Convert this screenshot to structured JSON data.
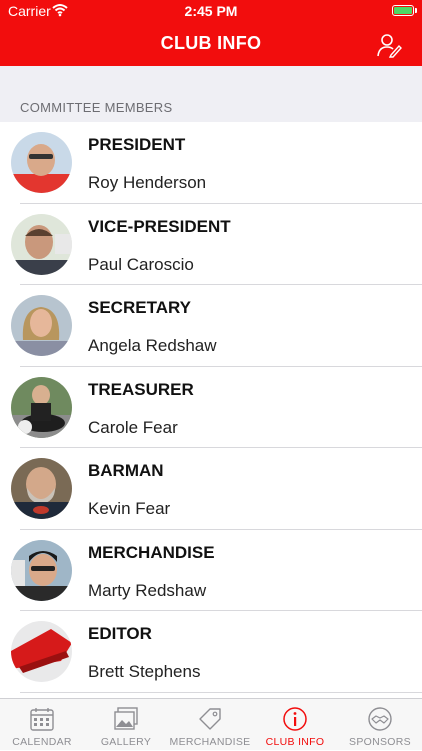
{
  "status": {
    "carrier": "Carrier",
    "time": "2:45 PM"
  },
  "nav": {
    "title": "CLUB INFO",
    "right_icon": "person-edit-icon"
  },
  "section": {
    "header": "COMMITTEE MEMBERS"
  },
  "members": [
    {
      "role": "PRESIDENT",
      "name": "Roy Henderson"
    },
    {
      "role": "VICE-PRESIDENT",
      "name": "Paul Caroscio"
    },
    {
      "role": "SECRETARY",
      "name": "Angela Redshaw"
    },
    {
      "role": "TREASURER",
      "name": "Carole Fear"
    },
    {
      "role": "BARMAN",
      "name": "Kevin Fear"
    },
    {
      "role": "MERCHANDISE",
      "name": "Marty Redshaw"
    },
    {
      "role": "EDITOR",
      "name": "Brett Stephens"
    }
  ],
  "tabs": [
    {
      "label": "CALENDAR",
      "icon": "calendar-icon"
    },
    {
      "label": "GALLERY",
      "icon": "gallery-icon"
    },
    {
      "label": "MERCHANDISE",
      "icon": "tag-icon"
    },
    {
      "label": "CLUB INFO",
      "icon": "info-icon",
      "active": true
    },
    {
      "label": "SPONSORS",
      "icon": "handshake-icon"
    }
  ],
  "colors": {
    "accent": "#f20d0d",
    "inactive": "#8e8e93",
    "section_bg": "#efeff4"
  }
}
